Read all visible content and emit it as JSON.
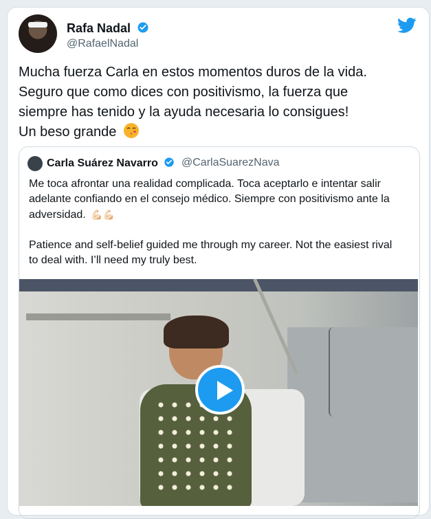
{
  "tweet": {
    "author_name": "Rafa Nadal",
    "author_handle": "@RafaelNadal",
    "lines": [
      "Mucha fuerza Carla en estos momentos duros de la vida.",
      "Seguro que como dices con positivismo, la fuerza que",
      "siempre has tenido y la ayuda necesaria lo consigues!",
      "Un beso grande"
    ]
  },
  "quoted": {
    "author_name": "Carla Suárez Navarro",
    "author_handle": "@CarlaSuarezNava",
    "paragraph_1_lines": [
      "Me toca afrontar una realidad complicada. Toca aceptarlo e intentar salir",
      "adelante confiando en el consejo médico. Siempre con positivismo ante la",
      "adversidad."
    ],
    "paragraph_2_lines": [
      "Patience and self-belief guided me through my career. Not the easiest rival",
      "to deal with. I’ll need my truly best."
    ],
    "strong_emoji": "💪🏻💪🏻"
  },
  "colors": {
    "accent": "#1d9bf0",
    "text": "#0f1419",
    "muted": "#536471"
  }
}
